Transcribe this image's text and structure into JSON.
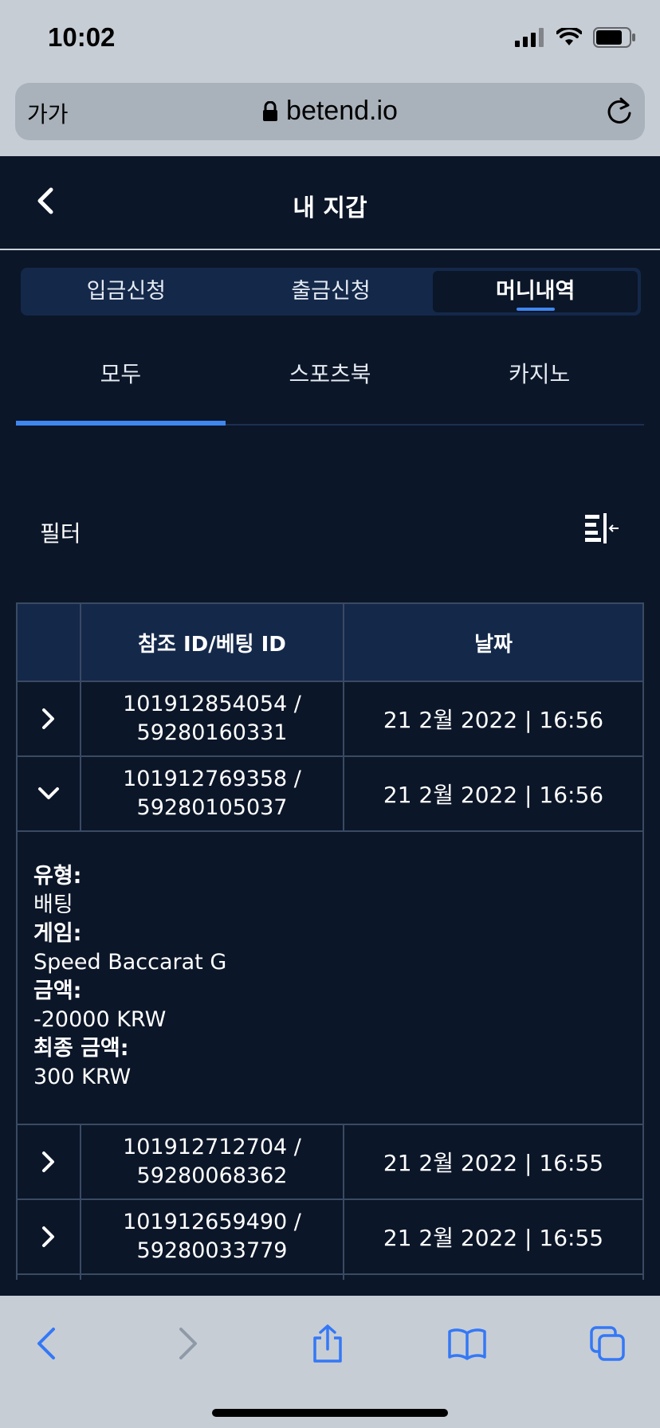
{
  "status_bar": {
    "time": "10:02"
  },
  "browser": {
    "text_size_button": "가가",
    "url": "betend.io"
  },
  "header": {
    "title": "내 지갑"
  },
  "tabs": [
    {
      "label": "입금신청",
      "active": false
    },
    {
      "label": "출금신청",
      "active": false
    },
    {
      "label": "머니내역",
      "active": true
    }
  ],
  "subtabs": [
    {
      "label": "모두",
      "active": true
    },
    {
      "label": "스포츠북",
      "active": false
    },
    {
      "label": "카지노",
      "active": false
    }
  ],
  "filter": {
    "label": "필터"
  },
  "table": {
    "headers": [
      "",
      "참조 ID/베팅 ID",
      "날짜"
    ],
    "rows": [
      {
        "ref_id": "101912854054 /",
        "bet_id": "59280160331",
        "date": "21 2월 2022 | 16:56",
        "expanded": false
      },
      {
        "ref_id": "101912769358 /",
        "bet_id": "59280105037",
        "date": "21 2월 2022 | 16:56",
        "expanded": true
      },
      {
        "ref_id": "101912712704 /",
        "bet_id": "59280068362",
        "date": "21 2월 2022 | 16:55",
        "expanded": false
      },
      {
        "ref_id": "101912659490 /",
        "bet_id": "59280033779",
        "date": "21 2월 2022 | 16:55",
        "expanded": false
      }
    ],
    "detail": {
      "type_label": "유형:",
      "type_value": "배팅",
      "game_label": "게임:",
      "game_value": "Speed Baccarat G",
      "amount_label": "금액:",
      "amount_value": "-20000 KRW",
      "final_label": "최종 금액:",
      "final_value": "300 KRW"
    }
  },
  "colors": {
    "background": "#0b1628",
    "accent": "#3f86f0",
    "header_bg": "#14284a",
    "browser_chrome": "#c7cdd5"
  }
}
